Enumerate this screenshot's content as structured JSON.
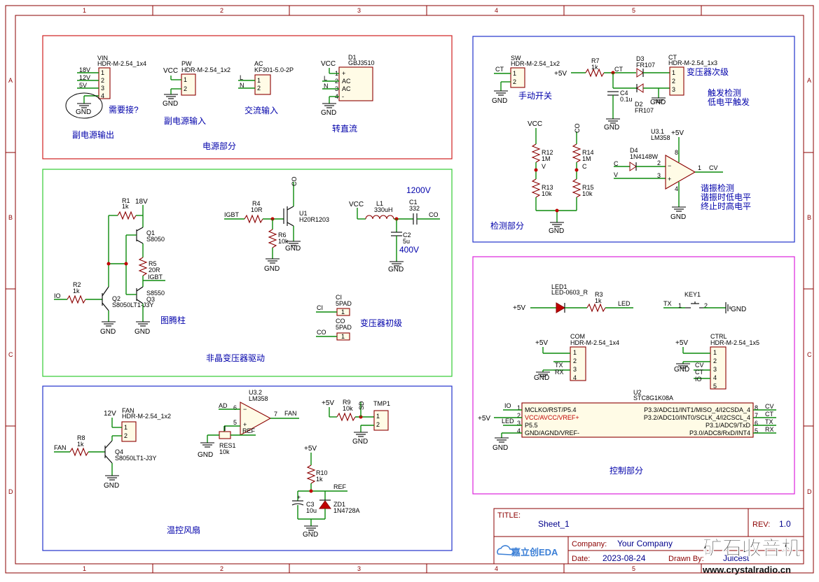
{
  "zones": {
    "cols": [
      "1",
      "2",
      "3",
      "4",
      "5"
    ],
    "rows": [
      "A",
      "B",
      "C",
      "D"
    ]
  },
  "blocks": {
    "power": {
      "title": "电源部分",
      "vin_name": "VIN",
      "vin_part": "HDR-M-2.54_1x4",
      "vin_nets": [
        "18V",
        "12V",
        "5V"
      ],
      "vin_note": "需要接?",
      "vin_caption": "副电源输出",
      "pw_name": "PW",
      "pw_part": "HDR-M-2.54_1x2",
      "pw_caption": "副电源输入",
      "ac_name": "AC",
      "ac_part": "KF301-5.0-2P",
      "ac_caption": "交流输入",
      "d1_name": "D1",
      "d1_part": "GBJ3510",
      "d1_pins": [
        "+",
        "AC",
        "AC",
        "-"
      ],
      "d1_nets": [
        "L",
        "N"
      ],
      "d1_caption": "转直流"
    },
    "detect": {
      "title": "检测部分",
      "sw_name": "SW",
      "sw_part": "HDR-M-2.54_1x2",
      "sw_caption": "手动开关",
      "r7": [
        "R7",
        "1k"
      ],
      "c4": [
        "C4",
        "0.1u"
      ],
      "d3": [
        "D3",
        "FR107"
      ],
      "d2": [
        "D2",
        "FR107"
      ],
      "ct_name": "CT",
      "ct_part": "HDR-M-2.54_1x3",
      "ct_caption": "变压器次级",
      "trigger_caption_1": "触发检测",
      "trigger_caption_2": "低电平触发",
      "r12": [
        "R12",
        "1M"
      ],
      "r13": [
        "R13",
        "10k"
      ],
      "r14": [
        "R14",
        "1M"
      ],
      "r15": [
        "R15",
        "10k"
      ],
      "u31": [
        "U3.1",
        "LM358"
      ],
      "d4": [
        "D4",
        "1N4148W"
      ],
      "osc_caption_1": "谐振检测",
      "osc_caption_2": "谐振时低电平",
      "osc_caption_3": "终止时高电平"
    },
    "driver": {
      "title": "非晶变压器驱动",
      "r1": [
        "R1",
        "1k"
      ],
      "q1": [
        "Q1",
        "S8050"
      ],
      "r5": [
        "R5",
        "20R"
      ],
      "q3": [
        "Q3",
        "S8550"
      ],
      "r2": [
        "R2",
        "1k"
      ],
      "q2": [
        "Q2",
        "S8050LT1-J3Y"
      ],
      "totem_caption": "图腾柱",
      "r4": [
        "R4",
        "10R"
      ],
      "r6": [
        "R6",
        "10k"
      ],
      "u1": [
        "U1",
        "H20R1203"
      ],
      "l1": [
        "L1",
        "330uH"
      ],
      "c1": [
        "C1",
        "332"
      ],
      "c2": [
        "C2",
        "5u"
      ],
      "v1200": "1200V",
      "v400": "400V",
      "ci": [
        "CI",
        "5PAD"
      ],
      "co": [
        "CO",
        "5PAD"
      ],
      "primary_caption": "变压器初级"
    },
    "fan": {
      "title": "温控风扇",
      "fan_name": "FAN",
      "fan_part": "HDR-M-2.54_1x2",
      "r8": [
        "R8",
        "1k"
      ],
      "q4": [
        "Q4",
        "S8050LT1-J3Y"
      ],
      "u32": [
        "U3.2",
        "LM358"
      ],
      "res1": [
        "RES1",
        "10k"
      ],
      "r9": [
        "R9",
        "10k"
      ],
      "tmp1": "TMP1",
      "r10": [
        "R10",
        "1k"
      ],
      "c3": [
        "C3",
        "10u"
      ],
      "zd1": [
        "ZD1",
        "1N4728A"
      ]
    },
    "control": {
      "title": "控制部分",
      "led1": [
        "LED1",
        "LED-0603_R"
      ],
      "r3": [
        "R3",
        "1k"
      ],
      "key1": "KEY1",
      "com_name": "COM",
      "com_part": "HDR-M-2.54_1x4",
      "ctrl_name": "CTRL",
      "ctrl_part": "HDR-M-2.54_1x5",
      "u2_name": "U2",
      "u2_part": "STC8G1K08A",
      "u2_left": [
        "MCLKO/RST/P5.4",
        "VCC/AVCC/VREF+",
        "P5.5",
        "GND/AGND/VREF-"
      ],
      "u2_right": [
        "P3.3/ADC11/INT1/MISO_4/I2CSDA_4",
        "P3.2/ADC10/INT0/SCLK_4/I2CSCL_4",
        "P3.1/ADC9/TxD",
        "P3.0/ADC8/RxD/INT4"
      ]
    }
  },
  "nets": {
    "vcc": "VCC",
    "gnd": "GND",
    "p5v": "+5V",
    "p12v": "12V",
    "p18v": "18V",
    "ct": "CT",
    "co": "CO",
    "ci": "CI",
    "cv": "CV",
    "c": "C",
    "v": "V",
    "io": "IO",
    "igbt": "IGBT",
    "fan": "FAN",
    "ref": "REF",
    "sd": "SD",
    "led": "LED",
    "tx": "TX",
    "rx": "RX",
    "l": "L",
    "n": "N"
  },
  "title_block": {
    "title_label": "TITLE:",
    "title_value": "Sheet_1",
    "rev_label": "REV:",
    "rev_value": "1.0",
    "brand": "嘉立创EDA",
    "company_label": "Company:",
    "company_value": "Your Company",
    "date_label": "Date:",
    "date_value": "2023-08-24",
    "drawn_label": "Drawn By:",
    "drawn_value": "Juicest"
  },
  "watermark": {
    "cn": "矿石收音机",
    "url": "www.crystalradio.cn"
  },
  "colors": {
    "frame": "#8b0000",
    "wire": "#0b8a0b",
    "power_box": "#d02020",
    "driver_box": "#33cc33",
    "detect_box": "#2233cc",
    "fan_box": "#2233cc",
    "control_box": "#dd22dd"
  }
}
